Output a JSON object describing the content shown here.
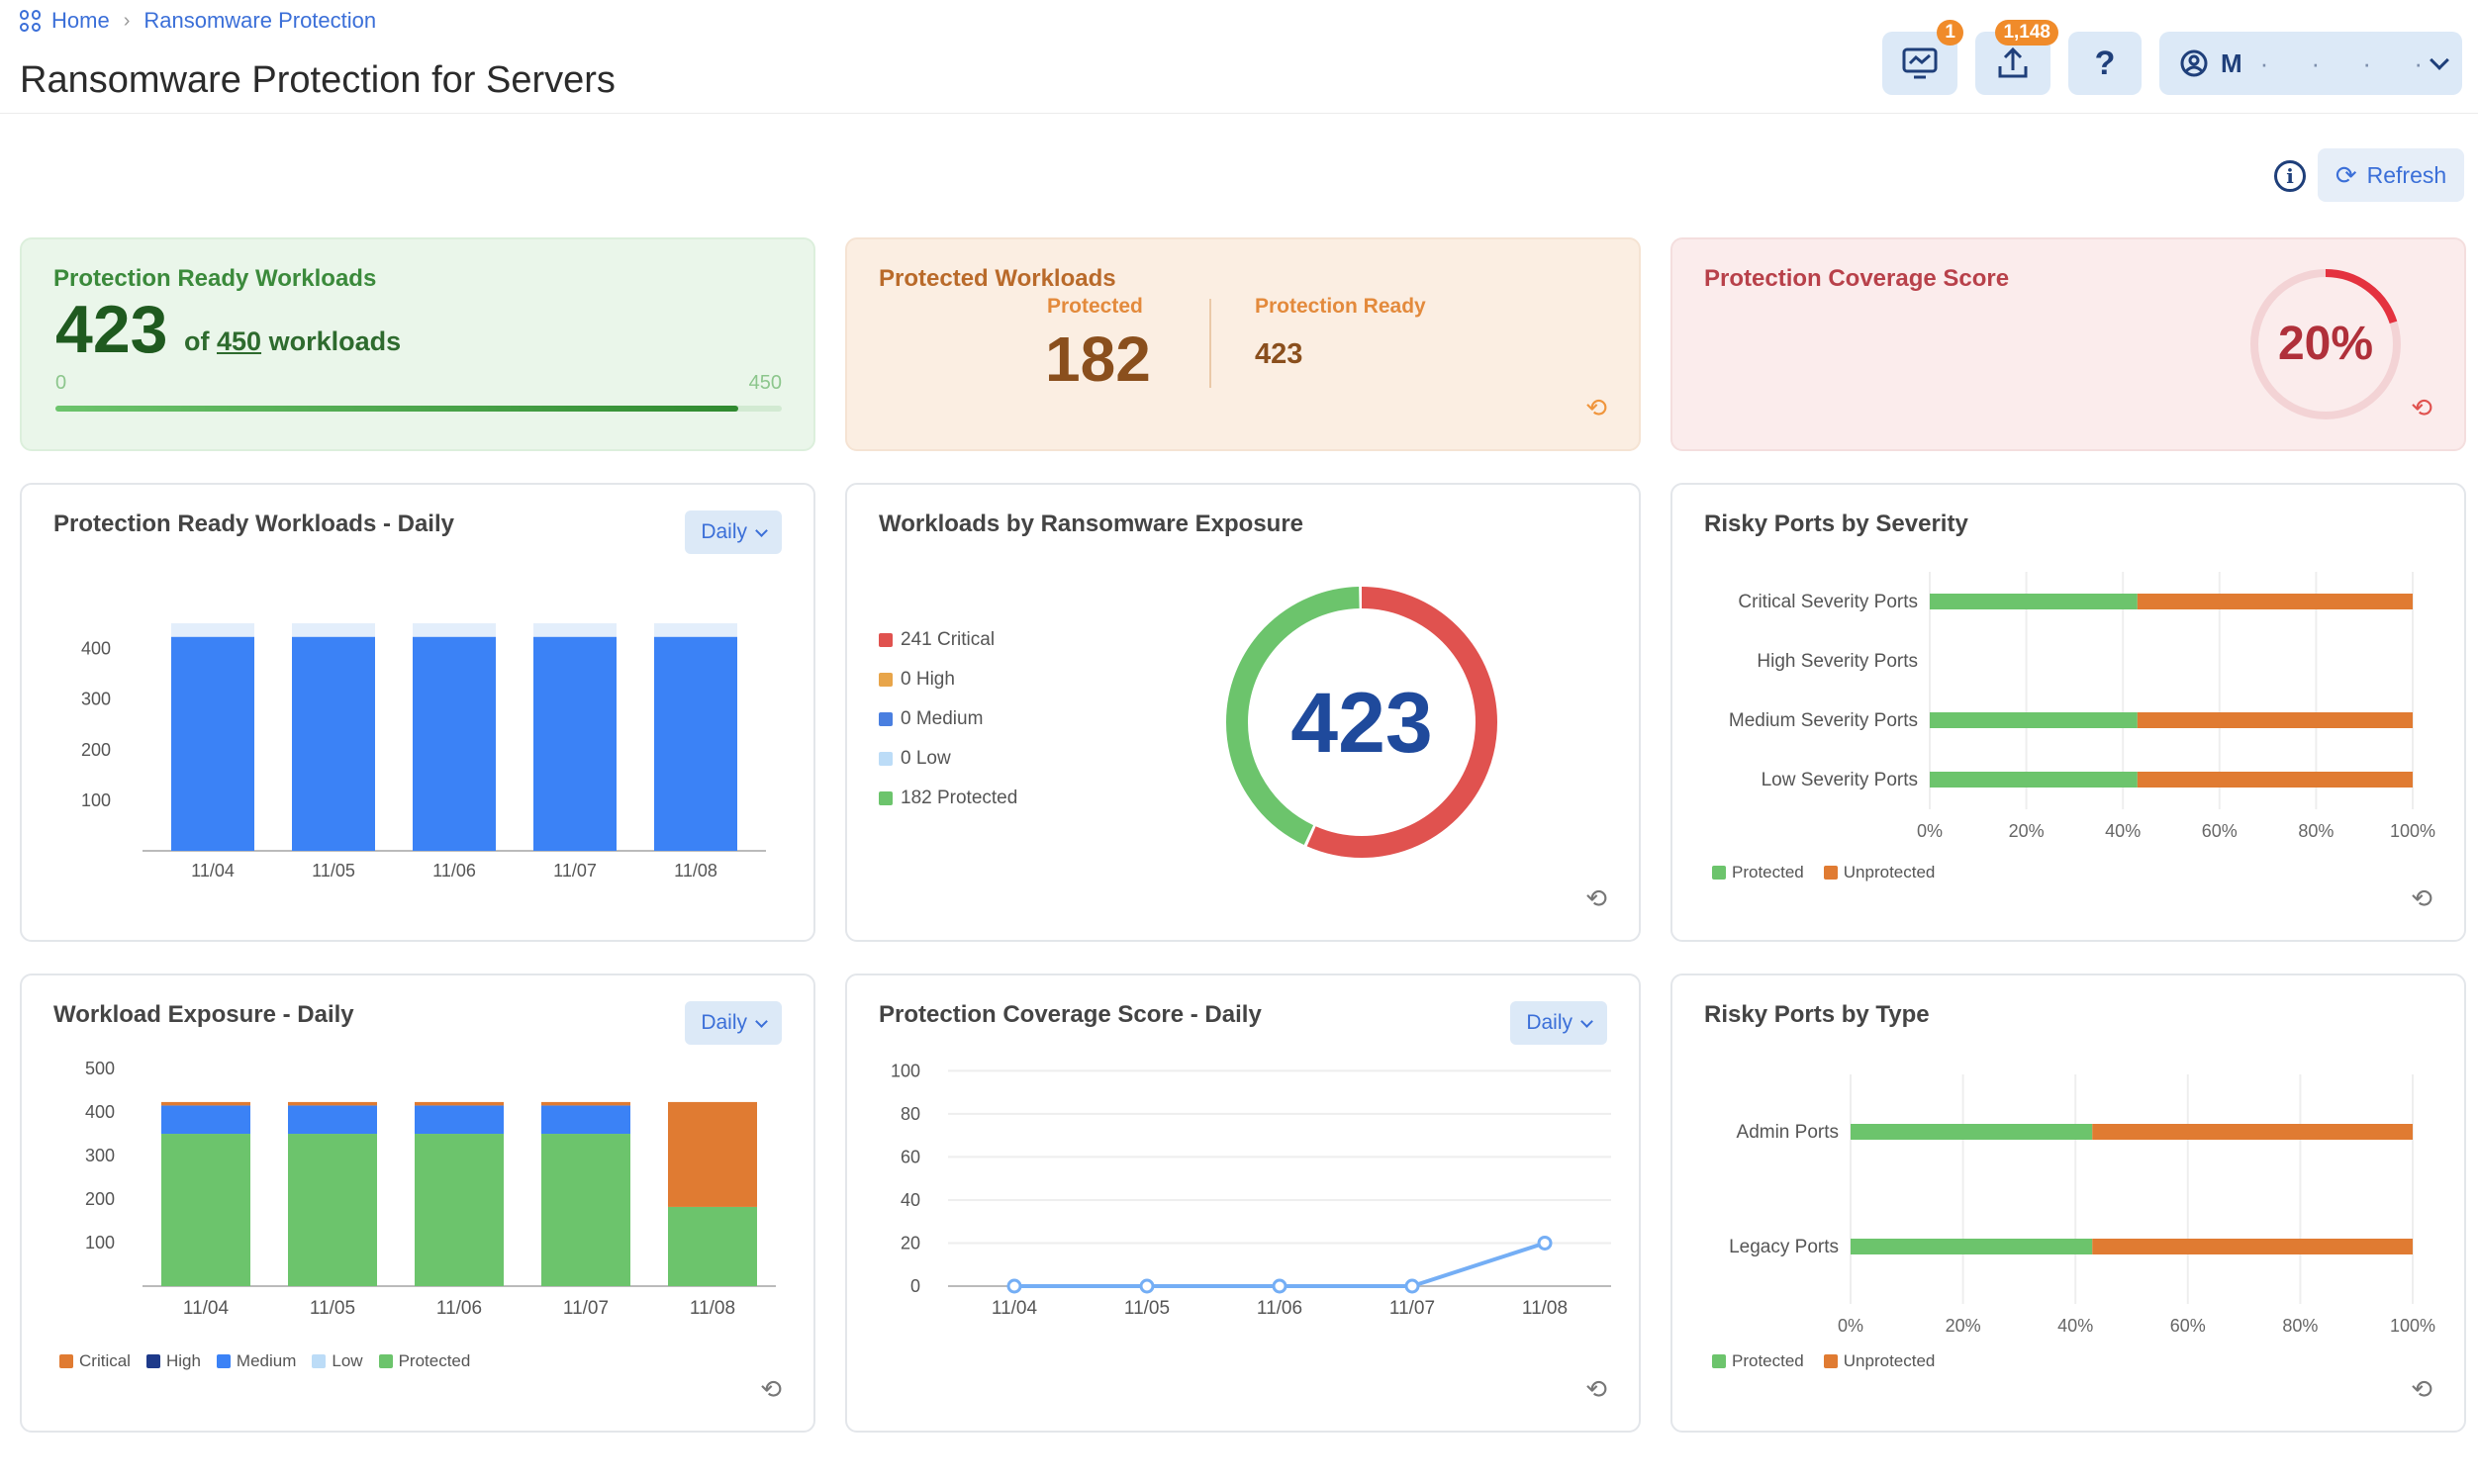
{
  "breadcrumb": {
    "home": "Home",
    "current": "Ransomware Protection"
  },
  "page_title": "Ransomware Protection for Servers",
  "header": {
    "notif_badge": "1",
    "upload_badge": "1,148",
    "help": "?",
    "user_initial": "M",
    "user_masked": "· · · ·"
  },
  "toolbar": {
    "refresh_label": "Refresh",
    "info": "i"
  },
  "kpi_ready": {
    "title": "Protection Ready Workloads",
    "value": "423",
    "of_prefix": "of",
    "total": "450",
    "suffix": "workloads",
    "min": "0",
    "max": "450",
    "progress": 0.94
  },
  "kpi_protected": {
    "title": "Protected Workloads",
    "protected_label": "Protected",
    "protected_value": "182",
    "ready_label": "Protection Ready",
    "ready_value": "423"
  },
  "kpi_coverage": {
    "title": "Protection Coverage Score",
    "value": "20%",
    "fraction": 0.2
  },
  "dropdown_label": "Daily",
  "colors": {
    "blue": "#3b82f6",
    "green": "#6cc46c",
    "orange": "#e07b32",
    "red": "#e0524f",
    "navy": "#1e3a8a",
    "lightblue": "#bcdcf7",
    "amber": "#e8a54a",
    "mid_blue": "#4a7fe0"
  },
  "charts": {
    "ready_daily": {
      "title": "Protection Ready Workloads - Daily"
    },
    "exposure": {
      "title": "Workloads by Ransomware Exposure"
    },
    "ports_severity": {
      "title": "Risky Ports by Severity"
    },
    "exposure_daily": {
      "title": "Workload Exposure - Daily"
    },
    "coverage_daily": {
      "title": "Protection Coverage Score - Daily"
    },
    "ports_type": {
      "title": "Risky Ports by Type"
    }
  },
  "legends": {
    "protected": "Protected",
    "unprotected": "Unprotected",
    "critical": "Critical",
    "high": "High",
    "medium": "Medium",
    "low": "Low"
  },
  "chart_data": [
    {
      "type": "bar",
      "categories": [
        "11/04",
        "11/05",
        "11/06",
        "11/07",
        "11/08"
      ],
      "values": [
        423,
        423,
        423,
        423,
        423
      ],
      "background_values": [
        450,
        450,
        450,
        450,
        450
      ],
      "yticks": [
        100,
        200,
        300,
        400
      ],
      "ylim": [
        0,
        450
      ]
    },
    {
      "type": "pie",
      "center_label": "423",
      "items": [
        {
          "label": "241 Critical",
          "value": 241,
          "color": "#e0524f"
        },
        {
          "label": "0 High",
          "value": 0,
          "color": "#e8a54a"
        },
        {
          "label": "0 Medium",
          "value": 0,
          "color": "#4a7fe0"
        },
        {
          "label": "0 Low",
          "value": 0,
          "color": "#bcdcf7"
        },
        {
          "label": "182 Protected",
          "value": 182,
          "color": "#6cc46c"
        }
      ]
    },
    {
      "type": "bar",
      "orientation": "horizontal",
      "categories": [
        "Critical Severity Ports",
        "High Severity Ports",
        "Medium Severity Ports",
        "Low Severity Ports"
      ],
      "series": [
        {
          "name": "Protected",
          "values": [
            43,
            0,
            43,
            43
          ]
        },
        {
          "name": "Unprotected",
          "values": [
            57,
            0,
            57,
            57
          ]
        }
      ],
      "xticks": [
        "0%",
        "20%",
        "40%",
        "60%",
        "80%",
        "100%"
      ],
      "xlim": [
        0,
        100
      ]
    },
    {
      "type": "bar",
      "stacked": true,
      "categories": [
        "11/04",
        "11/05",
        "11/06",
        "11/07",
        "11/08"
      ],
      "series": [
        {
          "name": "Protected",
          "values": [
            350,
            350,
            350,
            350,
            182
          ]
        },
        {
          "name": "Medium",
          "values": [
            65,
            65,
            65,
            65,
            0
          ]
        },
        {
          "name": "High",
          "values": [
            0,
            0,
            0,
            0,
            0
          ]
        },
        {
          "name": "Critical",
          "values": [
            8,
            8,
            8,
            8,
            241
          ]
        }
      ],
      "yticks": [
        100,
        200,
        300,
        400,
        500
      ],
      "ylim": [
        0,
        500
      ]
    },
    {
      "type": "line",
      "x": [
        "11/04",
        "11/05",
        "11/06",
        "11/07",
        "11/08"
      ],
      "values": [
        0,
        0,
        0,
        0,
        20
      ],
      "yticks": [
        0,
        20,
        40,
        60,
        80,
        100
      ],
      "ylim": [
        0,
        100
      ]
    },
    {
      "type": "bar",
      "orientation": "horizontal",
      "categories": [
        "Admin Ports",
        "Legacy Ports"
      ],
      "series": [
        {
          "name": "Protected",
          "values": [
            43,
            43
          ]
        },
        {
          "name": "Unprotected",
          "values": [
            57,
            57
          ]
        }
      ],
      "xticks": [
        "0%",
        "20%",
        "40%",
        "60%",
        "80%",
        "100%"
      ],
      "xlim": [
        0,
        100
      ]
    }
  ]
}
